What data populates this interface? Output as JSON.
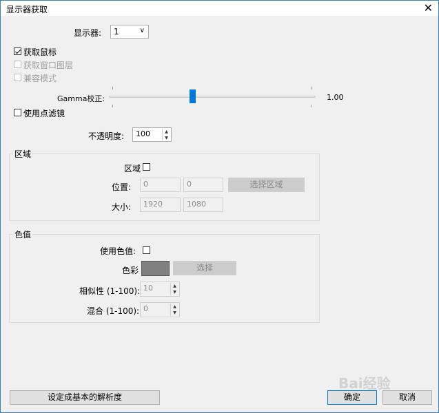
{
  "window": {
    "title": "显示器获取",
    "close_glyph": "✕"
  },
  "monitor": {
    "label": "显示器:",
    "value": "1"
  },
  "options": {
    "capture_mouse": {
      "label": "获取鼠标",
      "checked": true
    },
    "capture_layered": {
      "label": "获取窗口图层",
      "disabled": true
    },
    "compat_mode": {
      "label": "兼容模式",
      "disabled": true
    }
  },
  "gamma": {
    "label": "Gamma校正:",
    "value": "1.00"
  },
  "point_filter": {
    "label": "使用点滤镜"
  },
  "opacity": {
    "label": "不透明度:",
    "value": "100"
  },
  "region": {
    "group_label": "区域",
    "toggle_label": "区域",
    "position_label": "位置:",
    "position_x": "0",
    "position_y": "0",
    "select_region_btn": "选择区域",
    "size_label": "大小:",
    "size_w": "1920",
    "size_h": "1080"
  },
  "color_key": {
    "group_label": "色值",
    "use_label": "使用色值:",
    "color_label": "色彩",
    "color_swatch": "#808080",
    "select_btn": "选择",
    "similarity_label": "相似性 (1-100):",
    "similarity_value": "10",
    "blend_label": "混合 (1-100):",
    "blend_value": "0"
  },
  "footer": {
    "basic_resolution_btn": "设定成基本的解析度",
    "ok_btn": "确定",
    "cancel_btn": "取消"
  },
  "watermark": {
    "text": "Bai经验"
  },
  "colors": {
    "accent": "#0078d7",
    "border": "#3c7fb1"
  }
}
